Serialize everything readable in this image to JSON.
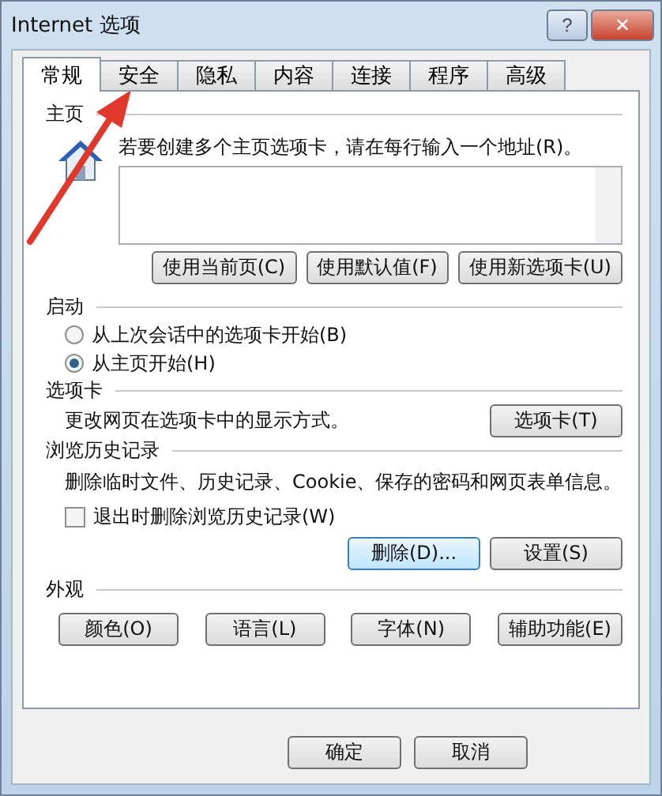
{
  "window": {
    "title": "Internet 选项",
    "help_label": "?",
    "close_label": "✕"
  },
  "tabs": [
    {
      "label": "常规",
      "selected": true
    },
    {
      "label": "安全",
      "selected": false
    },
    {
      "label": "隐私",
      "selected": false
    },
    {
      "label": "内容",
      "selected": false
    },
    {
      "label": "连接",
      "selected": false
    },
    {
      "label": "程序",
      "selected": false
    },
    {
      "label": "高级",
      "selected": false
    }
  ],
  "home_page": {
    "heading": "主页",
    "hint": "若要创建多个主页选项卡，请在每行输入一个地址(R)。",
    "buttons": [
      "使用当前页(C)",
      "使用默认值(F)",
      "使用新选项卡(U)"
    ]
  },
  "startup": {
    "heading": "启动",
    "options": [
      {
        "label": "从上次会话中的选项卡开始(B)",
        "selected": false
      },
      {
        "label": "从主页开始(H)",
        "selected": true
      }
    ]
  },
  "tabs_section": {
    "heading": "选项卡",
    "text": "更改网页在选项卡中的显示方式。",
    "button": "选项卡(T)"
  },
  "history": {
    "heading": "浏览历史记录",
    "text": "删除临时文件、历史记录、Cookie、保存的密码和网页表单信息。",
    "checkbox": {
      "label": "退出时删除浏览历史记录(W)",
      "checked": false
    },
    "buttons": [
      {
        "label": "删除(D)...",
        "focused": true
      },
      {
        "label": "设置(S)",
        "focused": false
      }
    ]
  },
  "appearance": {
    "heading": "外观",
    "buttons": [
      "颜色(O)",
      "语言(L)",
      "字体(N)",
      "辅助功能(E)"
    ]
  },
  "footer_buttons": [
    "确定",
    "取消"
  ],
  "annotation": {
    "kind": "arrow"
  }
}
